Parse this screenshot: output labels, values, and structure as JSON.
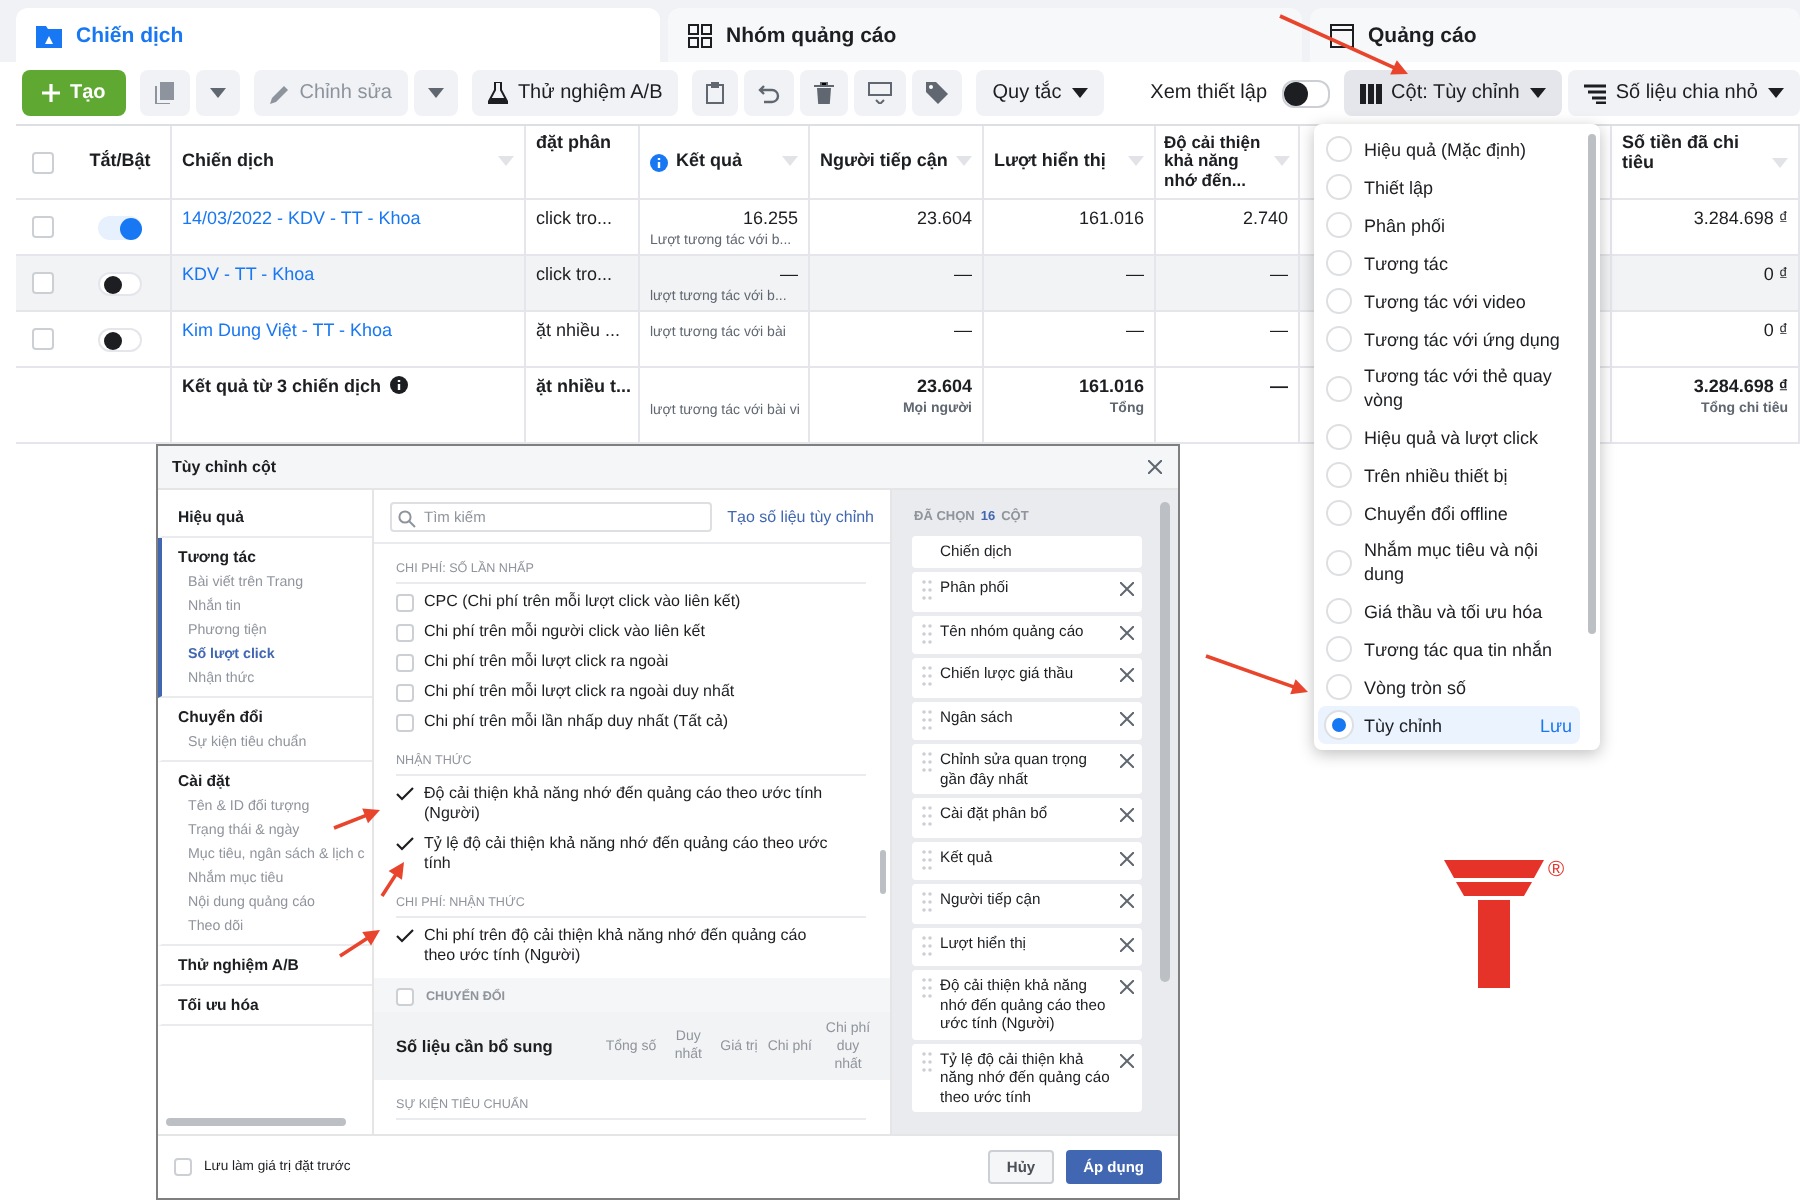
{
  "tabs": [
    {
      "label": "Chiến dịch",
      "selected": true,
      "kind": "campaign"
    },
    {
      "label": "Nhóm quảng cáo",
      "selected": false,
      "kind": "adset"
    },
    {
      "label": "Quảng cáo",
      "selected": false,
      "kind": "ad"
    }
  ],
  "toolbar": {
    "create": "Tạo",
    "edit": {
      "label": "Chỉnh sửa",
      "disabled": true
    },
    "ab_test": "Thử nghiệm A/B",
    "rules": "Quy tắc",
    "view_setup": {
      "label": "Xem thiết lập",
      "on": false
    },
    "columns_button": "Cột: Tùy chỉnh",
    "breakdown": "Số liệu chia nhỏ"
  },
  "table": {
    "select_all_checked": false,
    "columns": [
      "Tắt/Bật",
      "Chiến dịch",
      "đặt phân",
      "Kết quả",
      "Người tiếp cận",
      "Lượt hiển thị",
      "Độ cải thiện khả năng nhớ đến...",
      "Số tiền đã chi tiêu"
    ],
    "rows": [
      {
        "checked": false,
        "on": true,
        "highlighted": false,
        "campaign": "14/03/2022 - KDV - TT - Khoa",
        "column_4": "click tro...",
        "result": "16.255",
        "result_note": "Lượt tương tác với b...",
        "reach": "23.604",
        "impressions": "161.016",
        "recall": "2.740",
        "spend": "3.284.698 ₫"
      },
      {
        "checked": false,
        "on": false,
        "highlighted": true,
        "campaign": "KDV - TT - Khoa",
        "column_4": "click tro...",
        "result": "—",
        "result_note": "lượt tương tác với b...",
        "reach": "—",
        "impressions": "—",
        "recall": "—",
        "spend": "0 ₫"
      },
      {
        "checked": false,
        "on": false,
        "highlighted": false,
        "campaign": "Kim Dung Việt - TT - Khoa",
        "column_4": "ặt nhiều ...",
        "result_note": "lượt tương tác với bài",
        "reach": "—",
        "impressions": "—",
        "recall": "—",
        "spend": "0 ₫"
      }
    ],
    "total": {
      "label": "Kết quả từ 3 chiến dịch",
      "column_4": "ặt nhiều t...",
      "result_note": "lượt tương tác với bài vi",
      "reach": "23.604",
      "reach_note": "Mọi người",
      "impressions": "161.016",
      "impressions_note": "Tổng",
      "recall": "—",
      "spend": "3.284.698 ₫",
      "spend_note": "Tổng chi tiêu"
    }
  },
  "columns_menu": {
    "items": [
      {
        "label": "Hiệu quả (Mặc định)",
        "selected": false
      },
      {
        "label": "Thiết lập",
        "selected": false
      },
      {
        "label": "Phân phối",
        "selected": false
      },
      {
        "label": "Tương tác",
        "selected": false
      },
      {
        "label": "Tương tác với video",
        "selected": false
      },
      {
        "label": "Tương tác với ứng dụng",
        "selected": false
      },
      {
        "label": "Tương tác với thẻ quay vòng",
        "selected": false
      },
      {
        "label": "Hiệu quả và lượt click",
        "selected": false
      },
      {
        "label": "Trên nhiều thiết bị",
        "selected": false
      },
      {
        "label": "Chuyển đổi offline",
        "selected": false
      },
      {
        "label": "Nhắm mục tiêu và nội dung",
        "selected": false
      },
      {
        "label": "Giá thầu và tối ưu hóa",
        "selected": false
      },
      {
        "label": "Tương tác qua tin nhắn",
        "selected": false
      },
      {
        "label": "Vòng tròn số",
        "selected": false
      },
      {
        "label": "Tùy chỉnh",
        "selected": true,
        "action": "Lưu"
      }
    ]
  },
  "dialog": {
    "title": "Tùy chỉnh cột",
    "nav": [
      {
        "label": "Hiệu quả",
        "selected": false
      },
      {
        "label": "Tương tác",
        "selected": true,
        "children": [
          {
            "label": "Bài viết trên Trang",
            "selected": false
          },
          {
            "label": "Nhắn tin",
            "selected": false
          },
          {
            "label": "Phương tiện",
            "selected": false
          },
          {
            "label": "Số lượt click",
            "selected": true
          },
          {
            "label": "Nhận thức",
            "selected": false
          }
        ]
      },
      {
        "label": "Chuyển đổi",
        "selected": false,
        "children": [
          {
            "label": "Sự kiện tiêu chuẩn",
            "selected": false
          }
        ]
      },
      {
        "label": "Cài đặt",
        "selected": false,
        "children": [
          {
            "label": "Tên & ID đối tượng",
            "selected": false
          },
          {
            "label": "Trạng thái & ngày",
            "selected": false
          },
          {
            "label": "Mục tiêu, ngân sách & lịch c",
            "selected": false
          },
          {
            "label": "Nhắm mục tiêu",
            "selected": false
          },
          {
            "label": "Nội dung quảng cáo",
            "selected": false
          },
          {
            "label": "Theo dõi",
            "selected": false
          }
        ]
      },
      {
        "label": "Thử nghiệm A/B",
        "selected": false
      },
      {
        "label": "Tối ưu hóa",
        "selected": false
      }
    ],
    "search": {
      "placeholder": "Tìm kiếm"
    },
    "custom_metric_link": "Tạo số liệu tùy chỉnh",
    "sections": [
      {
        "title": "CHI PHÍ: SỐ LẦN NHẤP",
        "items": [
          {
            "label": "CPC (Chi phí trên mỗi lượt click vào liên kết)",
            "checked": false
          },
          {
            "label": "Chi phí trên mỗi người click vào liên kết",
            "checked": false
          },
          {
            "label": "Chi phí trên mỗi lượt click ra ngoài",
            "checked": false
          },
          {
            "label": "Chi phí trên mỗi lượt click ra ngoài duy nhất",
            "checked": false
          },
          {
            "label": "Chi phí trên mỗi lần nhấp duy nhất (Tất cả)",
            "checked": false
          }
        ]
      },
      {
        "title": "NHẬN THỨC",
        "items": [
          {
            "label": "Độ cải thiện khả năng nhớ đến quảng cáo theo ước tính (Người)",
            "checked": true
          },
          {
            "label": "Tỷ lệ độ cải thiện khả năng nhớ đến quảng cáo theo ước tính",
            "checked": true
          }
        ]
      },
      {
        "title": "CHI PHÍ: NHẬN THỨC",
        "items": [
          {
            "label": "Chi phí trên độ cải thiện khả năng nhớ đến quảng cáo theo ước tính (Người)",
            "checked": true
          }
        ]
      }
    ],
    "conversion_group": {
      "label": "CHUYỂN ĐỔI",
      "checked": false
    },
    "extra_metrics": {
      "title": "Số liệu cần bổ sung",
      "columns": [
        "Tổng số",
        "Duy nhất",
        "Giá trị",
        "Chi phí",
        "Chi phí duy nhất"
      ]
    },
    "standard_events_title": "SỰ KIỆN TIÊU CHUẨN",
    "selected_heading": {
      "before": "ĐÃ CHỌN",
      "count": "16",
      "after": "CỘT"
    },
    "selected_columns": [
      {
        "label": "Chiến dịch",
        "removable": false
      },
      {
        "label": "Phân phối",
        "removable": true
      },
      {
        "label": "Tên nhóm quảng cáo",
        "removable": true
      },
      {
        "label": "Chiến lược giá thầu",
        "removable": true
      },
      {
        "label": "Ngân sách",
        "removable": true
      },
      {
        "label": "Chỉnh sửa quan trọng gần đây nhất",
        "removable": true
      },
      {
        "label": "Cài đặt phân bổ",
        "removable": true
      },
      {
        "label": "Kết quả",
        "removable": true
      },
      {
        "label": "Người tiếp cận",
        "removable": true
      },
      {
        "label": "Lượt hiển thị",
        "removable": true
      },
      {
        "label": "Độ cải thiện khả năng nhớ đến quảng cáo theo ước tính (Người)",
        "removable": true
      },
      {
        "label": "Tỷ lệ độ cải thiện khả năng nhớ đến quảng cáo theo ước tính",
        "removable": true
      }
    ],
    "save_preset": {
      "label": "Lưu làm giá trị đặt trước",
      "checked": false
    },
    "cancel": "Hủy",
    "apply": "Áp dụng"
  },
  "logo": {
    "mark": "®"
  }
}
